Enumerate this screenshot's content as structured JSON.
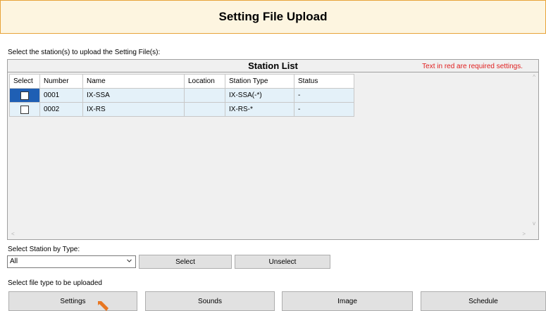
{
  "header": {
    "title": "Setting File Upload"
  },
  "instructions": {
    "select_stations": "Select the station(s) to upload the Setting File(s):",
    "select_by_type": "Select Station by Type:",
    "select_file_type": "Select file type to be uploaded"
  },
  "station_list": {
    "title": "Station List",
    "required_note": "Text in red are required settings.",
    "columns": [
      "Select",
      "Number",
      "Name",
      "Location",
      "Station Type",
      "Status"
    ],
    "rows": [
      {
        "selected": false,
        "number": "0001",
        "name": "IX-SSA",
        "location": "",
        "station_type": "IX-SSA(-*)",
        "status": "-"
      },
      {
        "selected": false,
        "number": "0002",
        "name": "IX-RS",
        "location": "",
        "station_type": "IX-RS-*",
        "status": "-"
      }
    ]
  },
  "type_filter": {
    "value": "All",
    "select_label": "Select",
    "unselect_label": "Unselect"
  },
  "file_types": {
    "settings": "Settings",
    "sounds": "Sounds",
    "image": "Image",
    "schedule": "Schedule"
  },
  "colors": {
    "header_bg": "#fdf5e0",
    "header_border": "#e8a33a",
    "row_bg": "#e4f1f9",
    "current_cell": "#1f5fb4",
    "required_text": "#e02020"
  }
}
